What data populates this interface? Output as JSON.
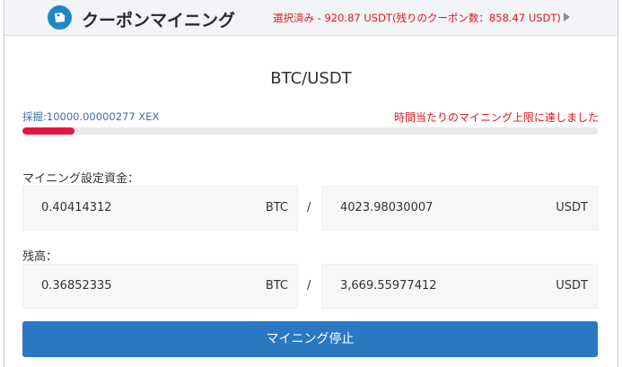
{
  "header": {
    "logo_icon": "coupon-icon",
    "title": "クーポンマイニング",
    "status": "選択済み - 920.87 USDT(残りのクーポン数：858.47 USDT)",
    "arrow_icon": "play-right-icon"
  },
  "mining": {
    "pair": "BTC/USDT",
    "mined": "採掘:10000.00000277 XEX",
    "limit_notice": "時間当たりのマイニング上限に達しました",
    "progress_fraction": 0.09
  },
  "funds": {
    "label": "マイニング設定資金：",
    "btc_value": "0.40414312",
    "btc_unit": "BTC",
    "separator": "/",
    "usdt_value": "4023.98030007",
    "usdt_unit": "USDT"
  },
  "balance": {
    "label": "残高：",
    "btc_value": "0.36852335",
    "btc_unit": "BTC",
    "separator": "/",
    "usdt_value": "3,669.55977412",
    "usdt_unit": "USDT"
  },
  "actions": {
    "stop_label": "マイニング停止"
  },
  "colors": {
    "accent_blue": "#2b78c2",
    "alert_red": "#e0161e",
    "progress_red": "#e5163d"
  }
}
